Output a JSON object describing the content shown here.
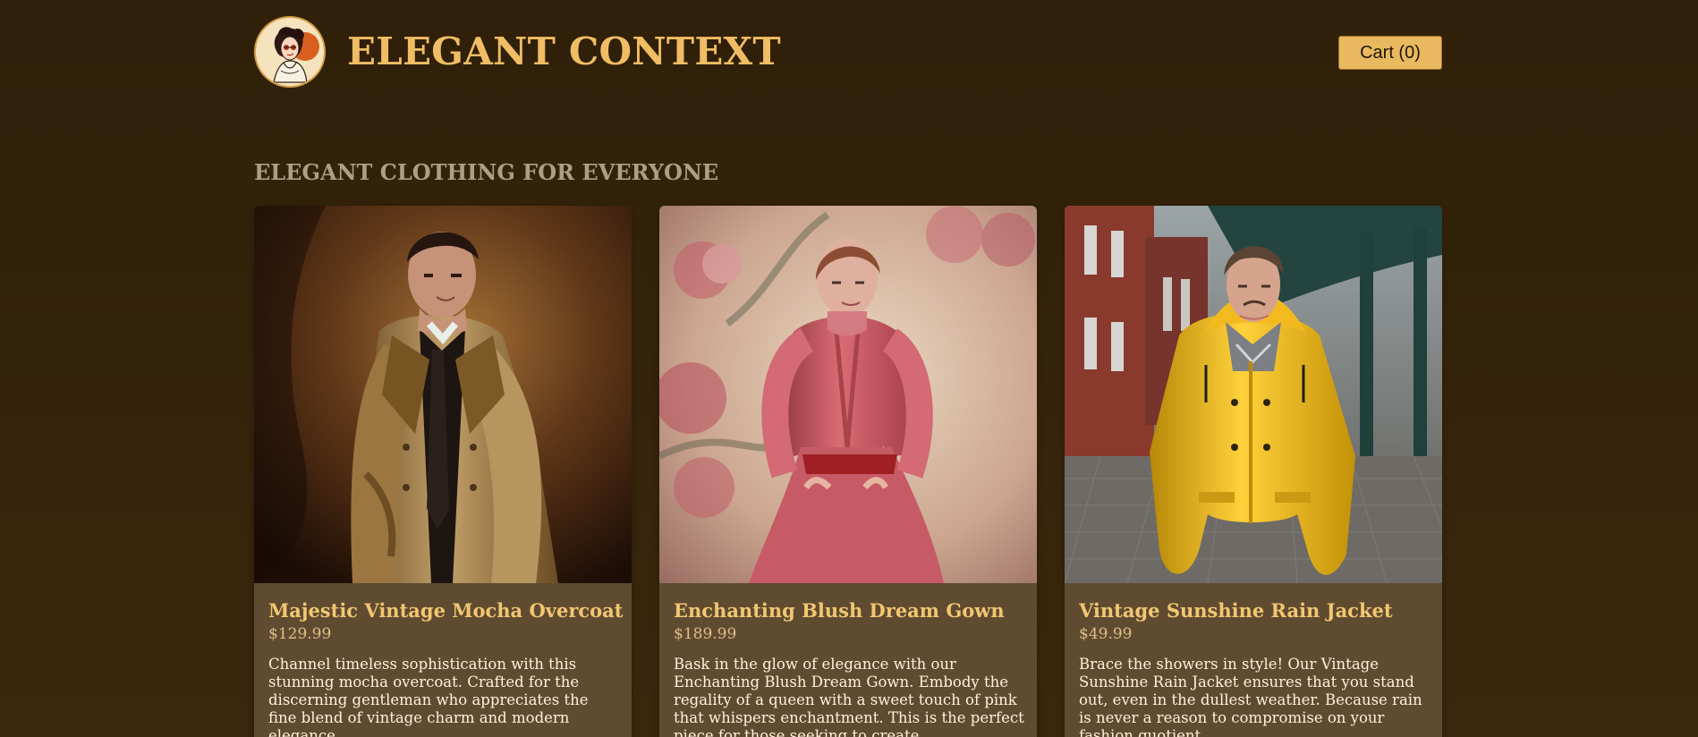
{
  "header": {
    "brand": "ELEGANT CONTEXT",
    "cart_label": "Cart (0)"
  },
  "main": {
    "section_title": "ELEGANT CLOTHING FOR EVERYONE",
    "products": [
      {
        "name": "Majestic Vintage Mocha Overcoat",
        "price": "$129.99",
        "description": "Channel timeless sophistication with this stunning mocha overcoat. Crafted for the discerning gentleman who appreciates the fine blend of vintage charm and modern elegance."
      },
      {
        "name": "Enchanting Blush Dream Gown",
        "price": "$189.99",
        "description": "Bask in the glow of elegance with our Enchanting Blush Dream Gown. Embody the regality of a queen with a sweet touch of pink that whispers enchantment. This is the perfect piece for those seeking to create unforgettable moments."
      },
      {
        "name": "Vintage Sunshine Rain Jacket",
        "price": "$49.99",
        "description": "Brace the showers in style! Our Vintage Sunshine Rain Jacket ensures that you stand out, even in the dullest weather. Because rain is never a reason to compromise on your fashion quotient."
      }
    ]
  },
  "colors": {
    "background": "#36240b",
    "accent": "#f0bd64",
    "card": "#5f4b30",
    "cart_button": "#e8b95f"
  },
  "icons": {
    "logo": "vintage-woman-logo-icon",
    "cart": "cart-button"
  }
}
